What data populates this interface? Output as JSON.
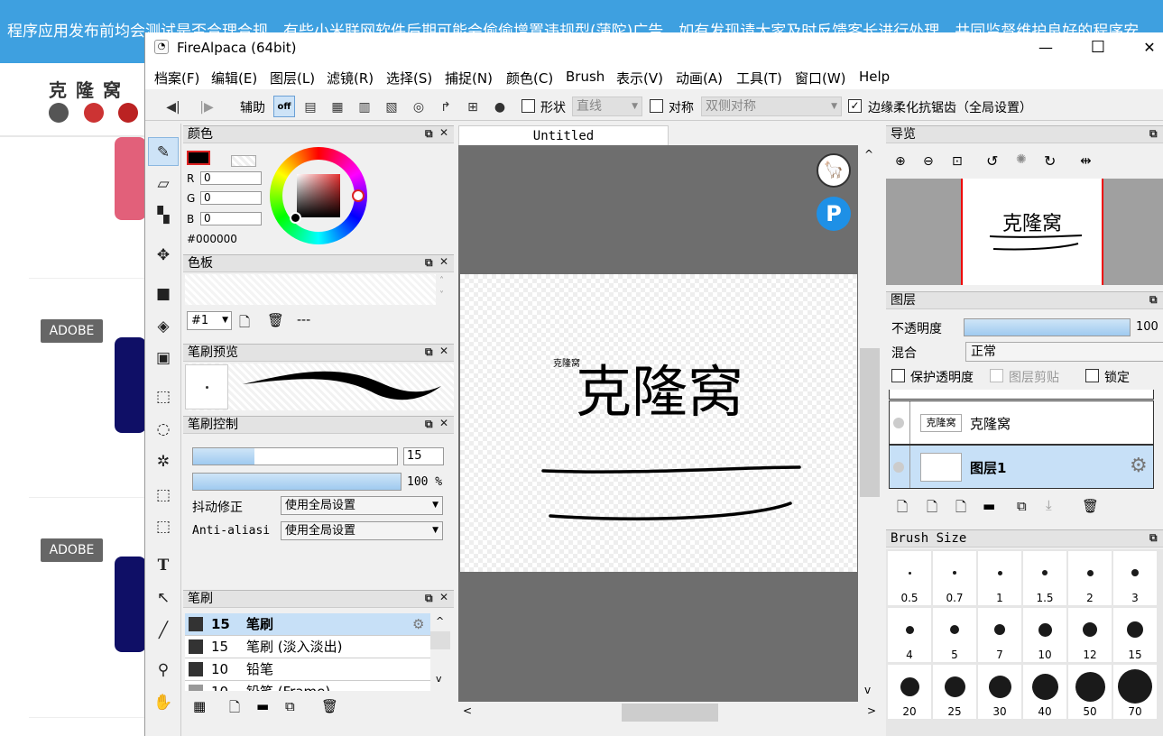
{
  "background_page": {
    "banner_text": "程序应用发布前均会测试是否合理合规，有些小米联网软件后期可能会偷偷增置违规型(蒲陀)广告，如有发现请大家及时反馈客长进行处理，共同监督维护良好的程序安",
    "logo_text": "克隆窝",
    "badges": [
      "ADOBE",
      "ADOBE"
    ]
  },
  "window": {
    "title": "FireAlpaca (64bit)",
    "minimize": "—",
    "maximize": "☐",
    "close": "✕"
  },
  "menu": [
    "档案(F)",
    "编辑(E)",
    "图层(L)",
    "滤镜(R)",
    "选择(S)",
    "捕捉(N)",
    "颜色(C)",
    "Brush",
    "表示(V)",
    "动画(A)",
    "工具(T)",
    "窗口(W)",
    "Help"
  ],
  "toolbar": {
    "assist_label": "辅助",
    "off_label": "off",
    "shape_label": "形状",
    "shape_value": "直线",
    "symmetry_label": "对称",
    "symmetry_value": "双侧对称",
    "antialias_label": "边缘柔化抗锯齿（全局设置）",
    "antialias_checked": true
  },
  "color_panel": {
    "title": "颜色",
    "r_label": "R",
    "r_value": "0",
    "g_label": "G",
    "g_value": "0",
    "b_label": "B",
    "b_value": "0",
    "hex": "#000000"
  },
  "palette_panel": {
    "title": "色板",
    "selector": "#1",
    "placeholder": "---"
  },
  "brush_preview_panel": {
    "title": "笔刷预览"
  },
  "brush_control_panel": {
    "title": "笔刷控制",
    "size_value": "15",
    "size_fraction": 0.3,
    "opacity_value": "100 %",
    "opacity_fraction": 1.0,
    "stabilizer_label": "抖动修正",
    "stabilizer_value": "使用全局设置",
    "aa_label": "Anti-aliasi",
    "aa_value": "使用全局设置"
  },
  "brush_panel": {
    "title": "笔刷",
    "items": [
      {
        "size": "15",
        "name": "笔刷",
        "selected": true
      },
      {
        "size": "15",
        "name": "笔刷 (淡入淡出)",
        "selected": false
      },
      {
        "size": "10",
        "name": "铅笔",
        "selected": false
      },
      {
        "size": "10",
        "name": "铅笔 (Frame)",
        "selected": false
      }
    ]
  },
  "canvas": {
    "tab": "Untitled",
    "small_text": "克隆窝",
    "big_text": "克隆窝"
  },
  "navigator_panel": {
    "title": "导览",
    "thumb_text": "克隆窝"
  },
  "layers_panel": {
    "title": "图层",
    "opacity_label": "不透明度",
    "opacity_value": "100",
    "opacity_fraction": 1.0,
    "blend_label": "混合",
    "blend_value": "正常",
    "protect_label": "保护透明度",
    "clip_label": "图层剪贴",
    "lock_label": "锁定",
    "layers": [
      {
        "name": "克隆窝",
        "thumb_text": "克隆窝",
        "selected": false
      },
      {
        "name": "图层1",
        "selected": true
      }
    ]
  },
  "brush_size_panel": {
    "title": "Brush Size",
    "sizes": [
      "0.5",
      "0.7",
      "1",
      "1.5",
      "2",
      "3",
      "4",
      "5",
      "7",
      "10",
      "12",
      "15",
      "20",
      "25",
      "30",
      "40",
      "50",
      "70"
    ]
  }
}
